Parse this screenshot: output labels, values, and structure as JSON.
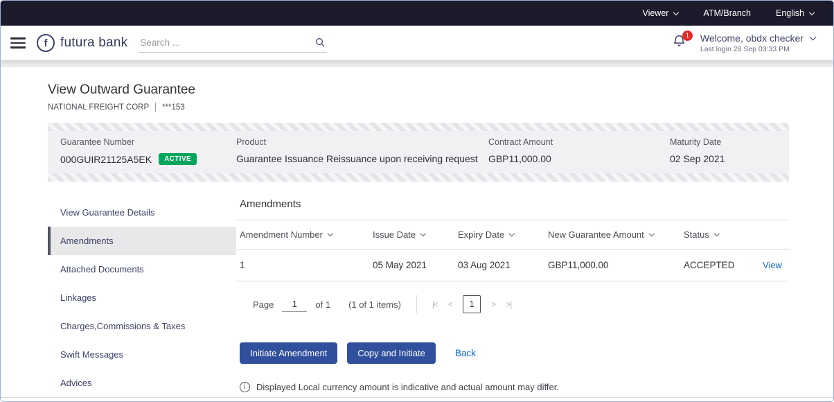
{
  "topbar": {
    "viewer_label": "Viewer",
    "atm_branch_label": "ATM/Branch",
    "language_label": "English"
  },
  "header": {
    "brand": "futura bank",
    "search_placeholder": "Search ...",
    "notification_count": "1",
    "welcome": "Welcome, obdx checker",
    "last_login": "Last login 28 Sep 03:33 PM"
  },
  "page": {
    "title": "View Outward Guarantee",
    "party_name": "NATIONAL FREIGHT CORP",
    "party_account": "***153"
  },
  "summary": {
    "guarantee_number": {
      "label": "Guarantee Number",
      "value": "000GUIR21125A5EK",
      "badge": "ACTIVE"
    },
    "product": {
      "label": "Product",
      "value": "Guarantee Issuance Reissuance upon receiving request"
    },
    "contract_amount": {
      "label": "Contract Amount",
      "value": "GBP11,000.00"
    },
    "maturity_date": {
      "label": "Maturity Date",
      "value": "02 Sep 2021"
    }
  },
  "sidebar": {
    "items": [
      {
        "label": "View Guarantee Details"
      },
      {
        "label": "Amendments"
      },
      {
        "label": "Attached Documents"
      },
      {
        "label": "Linkages"
      },
      {
        "label": "Charges,Commissions & Taxes"
      },
      {
        "label": "Swift Messages"
      },
      {
        "label": "Advices"
      }
    ]
  },
  "amendments": {
    "title": "Amendments",
    "headers": [
      "Amendment Number",
      "Issue Date",
      "Expiry Date",
      "New Guarantee Amount",
      "Status"
    ],
    "rows": [
      {
        "number": "1",
        "issue_date": "05 May 2021",
        "expiry_date": "03 Aug 2021",
        "amount": "GBP11,000.00",
        "status": "ACCEPTED",
        "action": "View"
      }
    ],
    "pagination": {
      "page_label": "Page",
      "page_value": "1",
      "of_label": "of 1",
      "items_label": "(1 of 1 items)",
      "first_icon": "|<",
      "prev_icon": "<",
      "current_page": "1",
      "next_icon": ">",
      "last_icon": ">|"
    },
    "buttons": {
      "initiate": "Initiate Amendment",
      "copy": "Copy and Initiate",
      "back": "Back"
    },
    "note": "Displayed Local currency amount is indicative and actual amount may differ."
  },
  "colors": {
    "topbar_bg": "#1b1b2b",
    "brand_navy": "#3c4269",
    "link_blue": "#0c66c2",
    "button_bg": "#30509d",
    "badge_active_green": "#00a55b",
    "notification_red": "#e02b27",
    "summary_bg": "#f1f1f3"
  }
}
